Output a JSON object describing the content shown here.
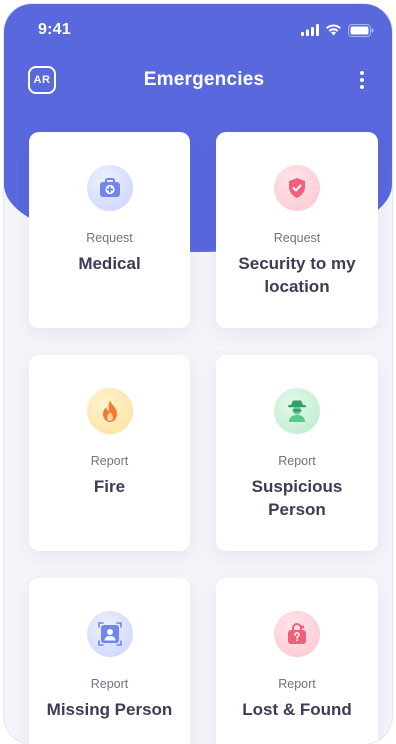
{
  "status_bar": {
    "time": "9:41",
    "icons": [
      "signal-icon",
      "wifi-icon",
      "battery-icon"
    ]
  },
  "navbar": {
    "ar_label": "AR",
    "title": "Emergencies",
    "more_icon": "more-vertical-icon"
  },
  "colors": {
    "header": "#5a68de",
    "background": "#f4f5fa",
    "card": "#ffffff",
    "title_text": "#3a3d56",
    "subtitle_text": "#6f7487"
  },
  "cards": [
    {
      "action": "Request",
      "title": "Medical",
      "icon": "medical-kit-icon"
    },
    {
      "action": "Request",
      "title": "Security to my location",
      "icon": "shield-icon"
    },
    {
      "action": "Report",
      "title": "Fire",
      "icon": "fire-icon"
    },
    {
      "action": "Report",
      "title": "Suspicious Person",
      "icon": "suspicious-person-icon"
    },
    {
      "action": "Report",
      "title": "Missing Person",
      "icon": "missing-person-icon"
    },
    {
      "action": "Report",
      "title": "Lost & Found",
      "icon": "lost-bag-icon"
    }
  ]
}
